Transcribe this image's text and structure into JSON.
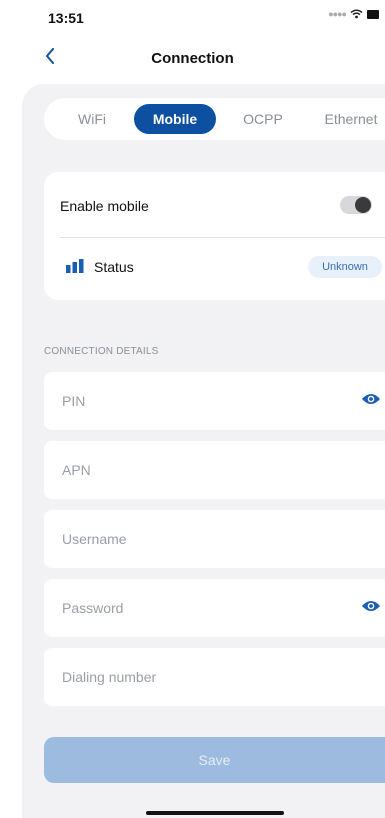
{
  "status_bar": {
    "time": "13:51",
    "signal_icon": "signal-dots-icon",
    "wifi_icon": "wifi-icon",
    "battery_icon": "battery-icon"
  },
  "nav": {
    "title": "Connection",
    "back_icon": "chevron-left-icon"
  },
  "tabs": [
    {
      "label": "WiFi",
      "selected": false
    },
    {
      "label": "Mobile",
      "selected": true
    },
    {
      "label": "OCPP",
      "selected": false
    },
    {
      "label": "Ethernet",
      "selected": false
    }
  ],
  "mobile_card": {
    "enable_label": "Enable mobile",
    "enable_value": false,
    "status_label": "Status",
    "status_icon": "signal-bars-icon",
    "status_value": "Unknown"
  },
  "connection_details": {
    "header": "CONNECTION DETAILS",
    "fields": {
      "pin": {
        "placeholder": "PIN",
        "value": "",
        "has_visibility_toggle": true
      },
      "apn": {
        "placeholder": "APN",
        "value": ""
      },
      "username": {
        "placeholder": "Username",
        "value": ""
      },
      "password": {
        "placeholder": "Password",
        "value": "",
        "has_visibility_toggle": true
      },
      "dialing_number": {
        "placeholder": "Dialing number",
        "value": ""
      }
    }
  },
  "save_label": "Save",
  "colors": {
    "accent": "#0d4fa0",
    "save_disabled": "#9cbbdf",
    "background": "#f2f2f5"
  }
}
